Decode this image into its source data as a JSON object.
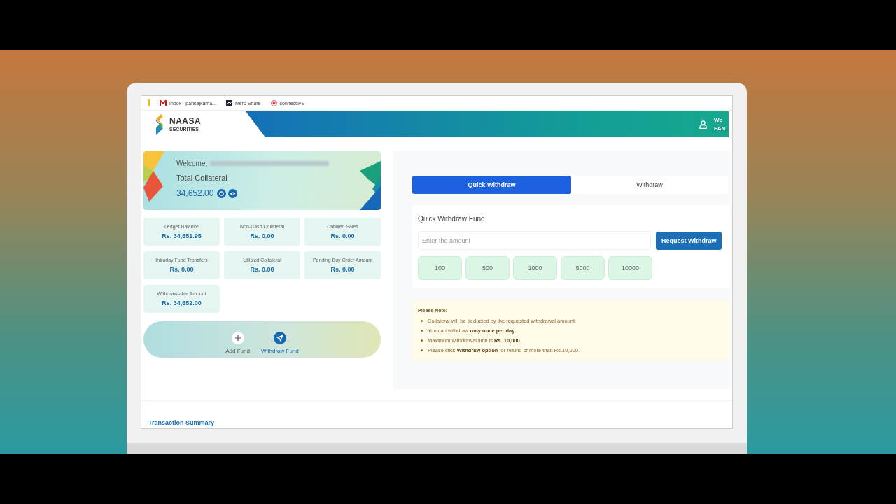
{
  "bookmarks": [
    {
      "kind": "mail",
      "label": "Inbox - pankajkuma..."
    },
    {
      "kind": "share",
      "label": "Mero Share"
    },
    {
      "kind": "ips",
      "label": "connectIPS"
    }
  ],
  "header": {
    "logo_name": "NAASA",
    "logo_sub": "SECURITIES",
    "user_lines": [
      "We",
      "PAN"
    ]
  },
  "collateral_card": {
    "welcome": "Welcome,",
    "title": "Total Collateral",
    "amount": "34,652.00"
  },
  "stats": [
    {
      "label": "Ledger Balance",
      "value": "Rs. 34,651.95"
    },
    {
      "label": "Non-Cash Collateral",
      "value": "Rs. 0.00"
    },
    {
      "label": "Unbilled Sales",
      "value": "Rs. 0.00"
    },
    {
      "label": "Intraday Fund Transfers",
      "value": "Rs. 0.00"
    },
    {
      "label": "Utilized Collateral",
      "value": "Rs. 0.00"
    },
    {
      "label": "Pending Buy Order Amount",
      "value": "Rs. 0.00"
    },
    {
      "label": "Withdraw-able Amount",
      "value": "Rs. 34,652.00"
    }
  ],
  "actions": [
    {
      "kind": "add",
      "label": "Add Fund",
      "selected": false
    },
    {
      "kind": "withdraw",
      "label": "Withdraw Fund",
      "selected": true
    }
  ],
  "tabs": [
    {
      "label": "Quick Withdraw",
      "selected": true
    },
    {
      "label": "Withdraw",
      "selected": false
    }
  ],
  "quick_withdraw": {
    "title": "Quick Withdraw Fund",
    "amount_field": {
      "placeholder": "Enter the amount"
    },
    "button": "Request Withdraw",
    "presets": [
      "100",
      "500",
      "1000",
      "5000",
      "10000"
    ]
  },
  "note": {
    "title": "Please Note:",
    "items": [
      "Collateral will be deducted by the requested withdrawal amount.",
      "You can withdraw **only once per day**.",
      "Maximum withdrawal limit is **Rs. 10,000**.",
      "Please click **Withdraw option** for refund of more than Rs.10,000."
    ]
  },
  "transaction_summary": "Transaction Summary"
}
